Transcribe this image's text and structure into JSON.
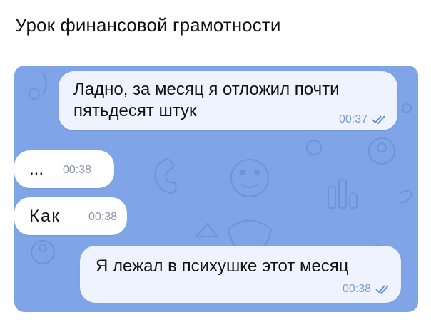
{
  "caption": "Урок финансовой грамотности",
  "messages": [
    {
      "text_line1": "Ладно, за месяц я отложил почти",
      "text_line2": "пятьдесят штук",
      "time": "00:37",
      "direction": "outgoing",
      "status_icon": "double-check-icon"
    },
    {
      "text": "...",
      "time": "00:38",
      "direction": "incoming"
    },
    {
      "text": "Как",
      "time": "00:38",
      "direction": "incoming"
    },
    {
      "text": "Я лежал в психушке этот месяц",
      "time": "00:38",
      "direction": "outgoing",
      "status_icon": "double-check-icon"
    }
  ],
  "colors": {
    "chat_background": "#7fa4e8",
    "outgoing_bubble": "#eef3ff",
    "incoming_bubble": "#ffffff",
    "tick": "#5f8fd8"
  }
}
